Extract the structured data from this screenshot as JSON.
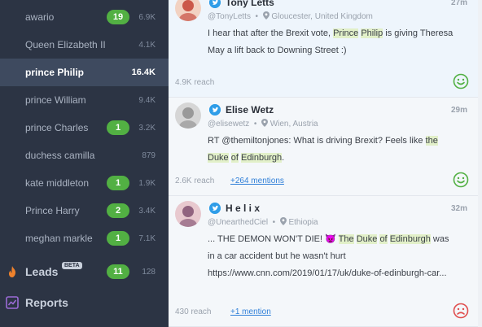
{
  "sidebar": {
    "keywords": [
      {
        "label": "awario",
        "badge": "19",
        "count": "6.9K",
        "active": false
      },
      {
        "label": "Queen Elizabeth II",
        "badge": "",
        "count": "4.1K",
        "active": false
      },
      {
        "label": "prince Philip",
        "badge": "",
        "count": "16.4K",
        "active": true
      },
      {
        "label": "prince William",
        "badge": "",
        "count": "9.4K",
        "active": false
      },
      {
        "label": "prince Charles",
        "badge": "1",
        "count": "3.2K",
        "active": false
      },
      {
        "label": "duchess camilla",
        "badge": "",
        "count": "879",
        "active": false
      },
      {
        "label": "kate middleton",
        "badge": "1",
        "count": "1.9K",
        "active": false
      },
      {
        "label": "Prince Harry",
        "badge": "2",
        "count": "3.4K",
        "active": false
      },
      {
        "label": "meghan markle",
        "badge": "1",
        "count": "7.1K",
        "active": false
      }
    ],
    "leads": {
      "label": "Leads",
      "beta": "BETA",
      "badge": "11",
      "count": "128"
    },
    "reports": {
      "label": "Reports"
    }
  },
  "feed": {
    "mentions": [
      {
        "author": "Tony Letts",
        "handle": "@TonyLetts",
        "location": "Gloucester, United Kingdom",
        "time": "27m",
        "text_parts": [
          {
            "t": "I hear that after the Brexit vote, ",
            "h": false
          },
          {
            "t": "Prince",
            "h": true
          },
          {
            "t": " ",
            "h": false
          },
          {
            "t": "Philip",
            "h": true
          },
          {
            "t": " is giving Theresa May a lift back to Downing Street :)",
            "h": false
          }
        ],
        "reach": "4.9K reach",
        "mentions_link": "",
        "sentiment": "positive"
      },
      {
        "author": "Elise Wetz",
        "handle": "@elisewetz",
        "location": "Wien, Austria",
        "time": "29m",
        "text_parts": [
          {
            "t": "RT @themiltonjones: What is driving Brexit? Feels like ",
            "h": false
          },
          {
            "t": "the",
            "h": true
          },
          {
            "t": " ",
            "h": false
          },
          {
            "t": "Duke",
            "h": true
          },
          {
            "t": " ",
            "h": false
          },
          {
            "t": "of",
            "h": true
          },
          {
            "t": " ",
            "h": false
          },
          {
            "t": "Edinburgh",
            "h": true
          },
          {
            "t": ".",
            "h": false
          }
        ],
        "reach": "2.6K reach",
        "mentions_link": "+264 mentions",
        "sentiment": "positive"
      },
      {
        "author": "H e l i x",
        "handle": "@UnearthedCiel",
        "location": "Ethiopia",
        "time": "32m",
        "text_parts": [
          {
            "t": "... THE DEMON WON'T DIE! ",
            "h": false
          },
          {
            "t": "👿",
            "h": false
          },
          {
            "t": " ",
            "h": false
          },
          {
            "t": "The",
            "h": true
          },
          {
            "t": " ",
            "h": false
          },
          {
            "t": "Duke",
            "h": true
          },
          {
            "t": " ",
            "h": false
          },
          {
            "t": "of",
            "h": true
          },
          {
            "t": " ",
            "h": false
          },
          {
            "t": "Edinburgh",
            "h": true
          },
          {
            "t": " was in a car accident but he wasn't hurt https://www.cnn.com/2019/01/17/uk/duke-of-edinburgh-car...",
            "h": false
          }
        ],
        "reach": "430 reach",
        "mentions_link": "+1 mention",
        "sentiment": "negative"
      }
    ]
  },
  "colors": {
    "sidebar_bg": "#2c3444",
    "active_bg": "#3e4a5f",
    "badge_green": "#52b043",
    "highlight": "#e2f0c9",
    "link_blue": "#2f7fd8",
    "positive": "#52b043",
    "negative": "#e04e4e",
    "twitter": "#2f9de8",
    "leads_icon": "#f0822c",
    "reports_icon": "#9b6bd6"
  },
  "icons": {
    "leads": "flame-icon",
    "reports": "chart-line-icon",
    "source": "twitter-bird-icon",
    "location": "location-pin-icon",
    "sentiment_positive": "smile-face-icon",
    "sentiment_negative": "frown-face-icon"
  }
}
